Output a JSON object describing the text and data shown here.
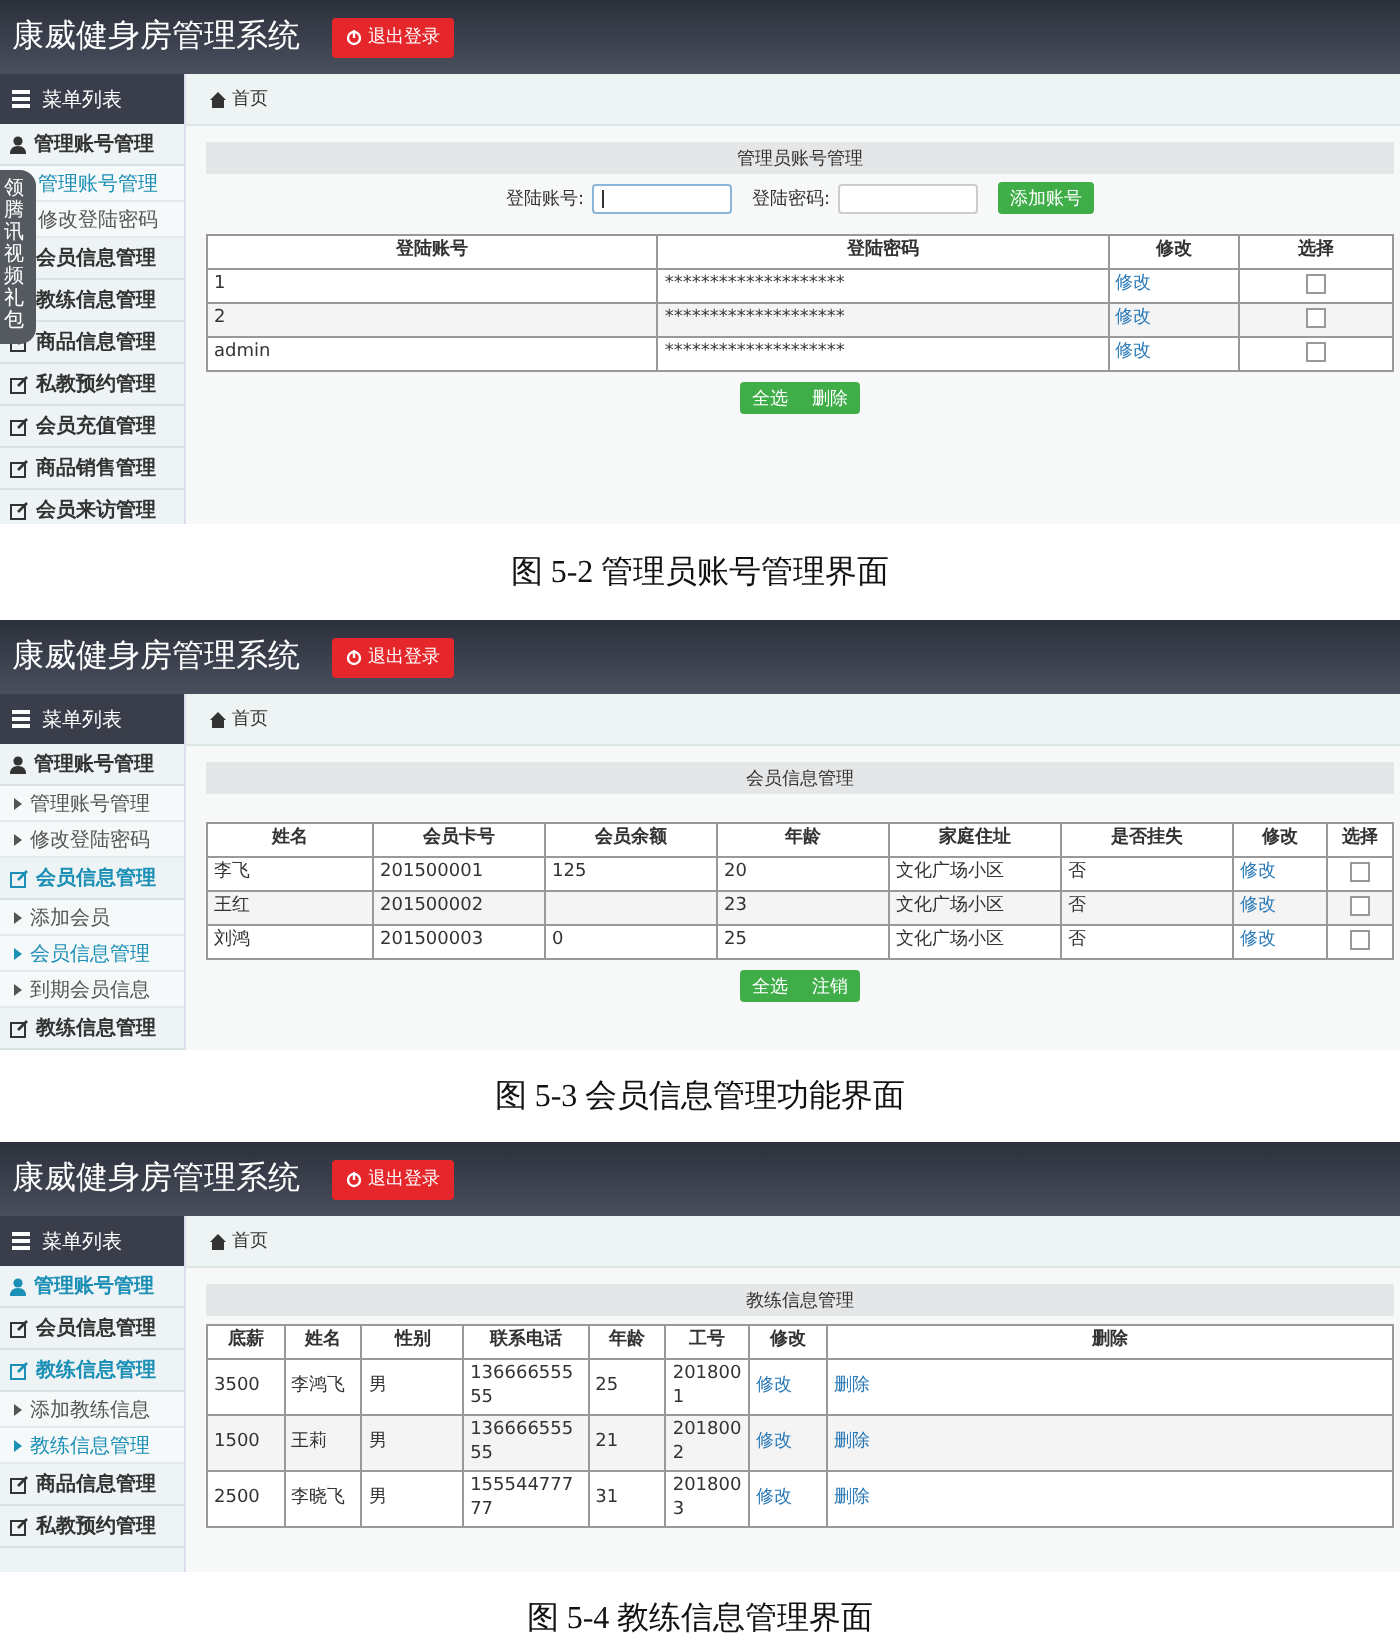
{
  "figures": [
    {
      "app_title": "康威健身房管理系统",
      "logout_button": "退出登录",
      "menu_title": "菜单列表",
      "breadcrumb": "首页",
      "overlay_tab": "领腾讯视频礼包",
      "sidebar": [
        {
          "label": "管理账号管理",
          "kind": "account",
          "selected": false,
          "children": [
            {
              "label": "管理账号管理",
              "selected": true
            },
            {
              "label": "修改登陆密码",
              "selected": false
            }
          ]
        },
        {
          "label": "会员信息管理",
          "kind": "module",
          "selected": false
        },
        {
          "label": "教练信息管理",
          "kind": "module",
          "selected": false
        },
        {
          "label": "商品信息管理",
          "kind": "module",
          "selected": false
        },
        {
          "label": "私教预约管理",
          "kind": "module",
          "selected": false
        },
        {
          "label": "会员充值管理",
          "kind": "module",
          "selected": false
        },
        {
          "label": "商品销售管理",
          "kind": "module",
          "selected": false
        },
        {
          "label": "会员来访管理",
          "kind": "module",
          "selected": false
        }
      ],
      "panel_title": "管理员账号管理",
      "form": {
        "fields": [
          {
            "label": "登陆账号:",
            "focused": true
          },
          {
            "label": "登陆密码:",
            "focused": false
          }
        ],
        "button": "添加账号"
      },
      "table": {
        "columns": [
          "登陆账号",
          "登陆密码",
          "修改",
          "选择"
        ],
        "rows": [
          {
            "cells": [
              {
                "kind": "text",
                "text": "1"
              },
              {
                "kind": "text",
                "text": "********************"
              },
              {
                "kind": "link",
                "text": "修改"
              },
              {
                "kind": "checkbox",
                "checked": false
              }
            ]
          },
          {
            "cells": [
              {
                "kind": "text",
                "text": "2"
              },
              {
                "kind": "text",
                "text": "********************"
              },
              {
                "kind": "link",
                "text": "修改"
              },
              {
                "kind": "checkbox",
                "checked": false
              }
            ]
          },
          {
            "cells": [
              {
                "kind": "text",
                "text": "admin"
              },
              {
                "kind": "text",
                "text": "********************"
              },
              {
                "kind": "link",
                "text": "修改"
              },
              {
                "kind": "checkbox",
                "checked": false
              }
            ]
          }
        ]
      },
      "actions": [
        "全选",
        "删除"
      ],
      "caption": "图 5-2  管理员账号管理界面"
    },
    {
      "app_title": "康威健身房管理系统",
      "logout_button": "退出登录",
      "menu_title": "菜单列表",
      "breadcrumb": "首页",
      "sidebar": [
        {
          "label": "管理账号管理",
          "kind": "account",
          "selected": false,
          "children": [
            {
              "label": "管理账号管理",
              "selected": false
            },
            {
              "label": "修改登陆密码",
              "selected": false
            }
          ]
        },
        {
          "label": "会员信息管理",
          "kind": "module",
          "selected": true,
          "children": [
            {
              "label": "添加会员",
              "selected": false
            },
            {
              "label": "会员信息管理",
              "selected": true
            },
            {
              "label": "到期会员信息",
              "selected": false
            }
          ]
        },
        {
          "label": "教练信息管理",
          "kind": "module",
          "selected": false
        }
      ],
      "panel_title": "会员信息管理",
      "table": {
        "columns": [
          "姓名",
          "会员卡号",
          "会员余额",
          "年龄",
          "家庭住址",
          "是否挂失",
          "修改",
          "选择"
        ],
        "rows": [
          {
            "cells": [
              {
                "kind": "text",
                "text": "李飞"
              },
              {
                "kind": "text",
                "text": "201500001"
              },
              {
                "kind": "text",
                "text": "125"
              },
              {
                "kind": "text",
                "text": "20"
              },
              {
                "kind": "text",
                "text": "文化广场小区"
              },
              {
                "kind": "text",
                "text": "否"
              },
              {
                "kind": "link",
                "text": "修改"
              },
              {
                "kind": "checkbox",
                "checked": false
              }
            ]
          },
          {
            "cells": [
              {
                "kind": "text",
                "text": "王红"
              },
              {
                "kind": "text",
                "text": "201500002"
              },
              {
                "kind": "text"
              },
              {
                "kind": "text",
                "text": "23"
              },
              {
                "kind": "text",
                "text": "文化广场小区"
              },
              {
                "kind": "text",
                "text": "否"
              },
              {
                "kind": "link",
                "text": "修改"
              },
              {
                "kind": "checkbox",
                "checked": false
              }
            ]
          },
          {
            "cells": [
              {
                "kind": "text",
                "text": "刘鸿"
              },
              {
                "kind": "text",
                "text": "201500003"
              },
              {
                "kind": "text",
                "text": "0"
              },
              {
                "kind": "text",
                "text": "25"
              },
              {
                "kind": "text",
                "text": "文化广场小区"
              },
              {
                "kind": "text",
                "text": "否"
              },
              {
                "kind": "link",
                "text": "修改"
              },
              {
                "kind": "checkbox",
                "checked": false
              }
            ]
          }
        ]
      },
      "actions": [
        "全选",
        "注销"
      ],
      "caption": "图 5-3 会员信息管理功能界面"
    },
    {
      "app_title": "康威健身房管理系统",
      "logout_button": "退出登录",
      "menu_title": "菜单列表",
      "breadcrumb": "首页",
      "sidebar": [
        {
          "label": "管理账号管理",
          "kind": "account",
          "selected": true
        },
        {
          "label": "会员信息管理",
          "kind": "module",
          "selected": false
        },
        {
          "label": "教练信息管理",
          "kind": "module",
          "selected": true,
          "children": [
            {
              "label": "添加教练信息",
              "selected": false
            },
            {
              "label": "教练信息管理",
              "selected": true
            }
          ]
        },
        {
          "label": "商品信息管理",
          "kind": "module",
          "selected": false
        },
        {
          "label": "私教预约管理",
          "kind": "module",
          "selected": false
        }
      ],
      "panel_title": "教练信息管理",
      "table": {
        "columns": [
          "底薪",
          "姓名",
          "性别",
          "联系电话",
          "年龄",
          "工号",
          "修改",
          "删除"
        ],
        "rows": [
          {
            "cells": [
              {
                "kind": "text",
                "text": "3500"
              },
              {
                "kind": "text",
                "text": "李鸿飞"
              },
              {
                "kind": "text",
                "text": "男"
              },
              {
                "kind": "text",
                "text": "13666655555"
              },
              {
                "kind": "text",
                "text": "25"
              },
              {
                "kind": "text",
                "text": "2018001"
              },
              {
                "kind": "link",
                "text": "修改"
              },
              {
                "kind": "link",
                "text": "删除"
              }
            ]
          },
          {
            "cells": [
              {
                "kind": "text",
                "text": "1500"
              },
              {
                "kind": "text",
                "text": "王莉"
              },
              {
                "kind": "text",
                "text": "男"
              },
              {
                "kind": "text",
                "text": "13666655555"
              },
              {
                "kind": "text",
                "text": "21"
              },
              {
                "kind": "text",
                "text": "2018002"
              },
              {
                "kind": "link",
                "text": "修改"
              },
              {
                "kind": "link",
                "text": "删除"
              }
            ]
          },
          {
            "cells": [
              {
                "kind": "text",
                "text": "2500"
              },
              {
                "kind": "text",
                "text": "李晓飞"
              },
              {
                "kind": "text",
                "text": "男"
              },
              {
                "kind": "text",
                "text": "15554477777"
              },
              {
                "kind": "text",
                "text": "31"
              },
              {
                "kind": "text",
                "text": "2018003"
              },
              {
                "kind": "link",
                "text": "修改"
              },
              {
                "kind": "link",
                "text": "删除"
              }
            ]
          }
        ]
      },
      "caption": "图 5-4  教练信息管理界面"
    }
  ]
}
